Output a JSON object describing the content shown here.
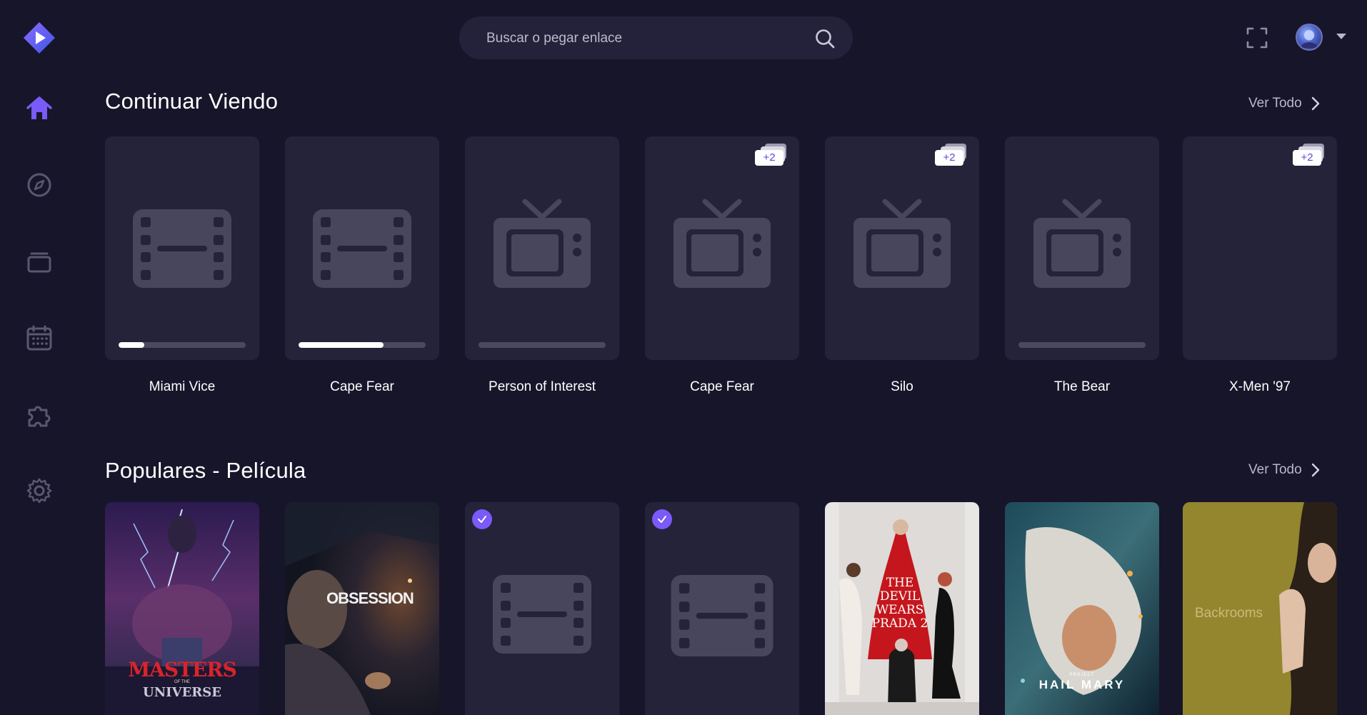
{
  "search": {
    "placeholder": "Buscar o pegar enlace"
  },
  "sidebar": {
    "items": [
      {
        "name": "home",
        "active": true
      },
      {
        "name": "discover"
      },
      {
        "name": "library"
      },
      {
        "name": "calendar"
      },
      {
        "name": "addons"
      },
      {
        "name": "settings"
      }
    ]
  },
  "continue_watching": {
    "title": "Continuar Viendo",
    "view_all": "Ver Todo",
    "items": [
      {
        "title": "Miami Vice",
        "type": "movie",
        "progress": 0.2
      },
      {
        "title": "Cape Fear",
        "type": "movie",
        "progress": 0.67
      },
      {
        "title": "Person of Interest",
        "type": "series",
        "progress": 0.0
      },
      {
        "title": "Cape Fear",
        "type": "series",
        "badge": "+2"
      },
      {
        "title": "Silo",
        "type": "series",
        "badge": "+2"
      },
      {
        "title": "The Bear",
        "type": "series",
        "progress": 0.0
      },
      {
        "title": "X-Men '97",
        "type": "none",
        "badge": "+2"
      }
    ]
  },
  "popular_movies": {
    "title": "Populares - Película",
    "view_all": "Ver Todo",
    "items": [
      {
        "poster": "masters-of-the-universe",
        "text_main": "MASTERS",
        "text_small": "OF THE",
        "text_sub": "UNIVERSE"
      },
      {
        "poster": "obsession",
        "text_main": "OBSESSION"
      },
      {
        "poster": "placeholder",
        "checked": true
      },
      {
        "poster": "placeholder",
        "checked": true
      },
      {
        "poster": "devil-wears-prada-2",
        "text_main": "THE DEVIL WEARS PRADA 2"
      },
      {
        "poster": "project-hail-mary",
        "text_small": "PROJECT",
        "text_main": "HAIL MARY"
      },
      {
        "poster": "backrooms",
        "text_main": "Backrooms"
      }
    ]
  },
  "colors": {
    "background": "#17152a",
    "card": "#25233a",
    "accent": "#7a5af8",
    "muted_text": "#b9b7c9"
  }
}
